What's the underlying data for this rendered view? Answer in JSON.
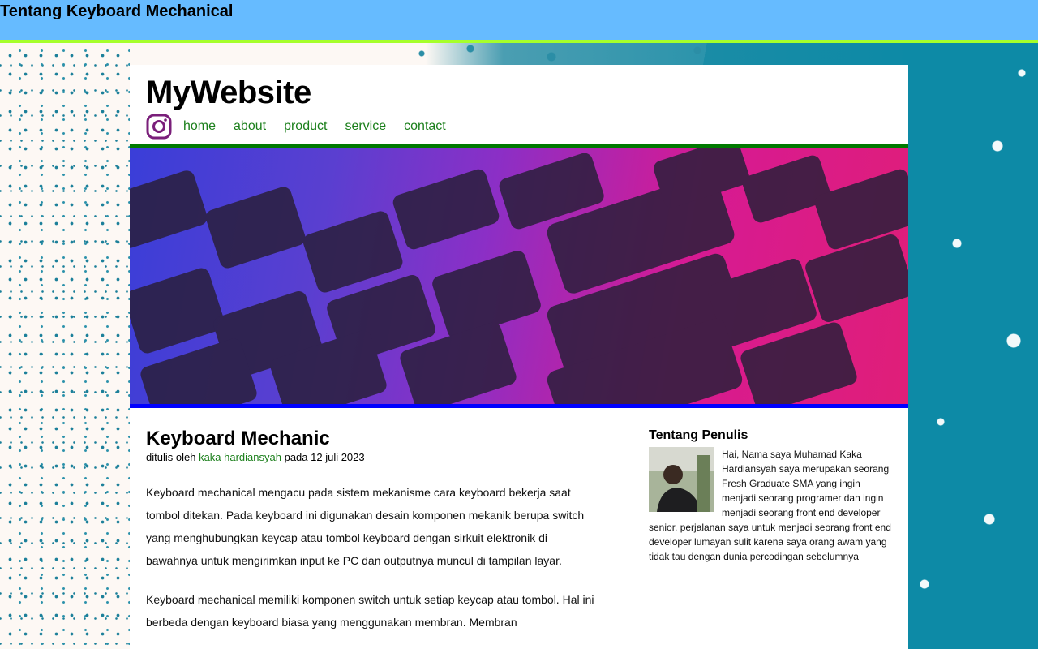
{
  "topbar": {
    "title": "Tentang Keyboard Mechanical"
  },
  "header": {
    "site_title": "MyWebsite",
    "nav": [
      "home",
      "about",
      "product",
      "service",
      "contact"
    ],
    "social_icon": "instagram-icon"
  },
  "hero": {
    "image": "keyboard-photo"
  },
  "article": {
    "title": "Keyboard Mechanic",
    "byline_prefix": "ditulis oleh",
    "author": "kaka hardiansyah",
    "byline_suffix": "pada 12 juli 2023",
    "paragraphs": [
      "Keyboard mechanical mengacu pada sistem mekanisme cara keyboard bekerja saat tombol ditekan. Pada keyboard ini digunakan desain komponen mekanik berupa switch yang menghubungkan keycap atau tombol keyboard dengan sirkuit elektronik di bawahnya untuk mengirimkan input ke PC dan outputnya muncul di tampilan layar.",
      "Keyboard mechanical memiliki komponen switch untuk setiap keycap atau tombol. Hal ini berbeda dengan keyboard biasa yang menggunakan membran. Membran"
    ]
  },
  "sidebar": {
    "title": "Tentang Penulis",
    "bio": "Hai, Nama saya Muhamad Kaka Hardiansyah saya merupakan seorang Fresh Graduate SMA yang ingin menjadi seorang programer dan ingin menjadi seorang front end developer senior. perjalanan saya untuk menjadi seorang front end developer lumayan sulit karena saya orang awam yang tidak tau dengan dunia percodingan sebelumnya"
  },
  "colors": {
    "topbar_bg": "#66bbff",
    "topbar_border": "#a6ff2b",
    "link": "#1b7f1b",
    "hero_top_border": "#007a00",
    "hero_bottom_border": "#0000ff"
  }
}
